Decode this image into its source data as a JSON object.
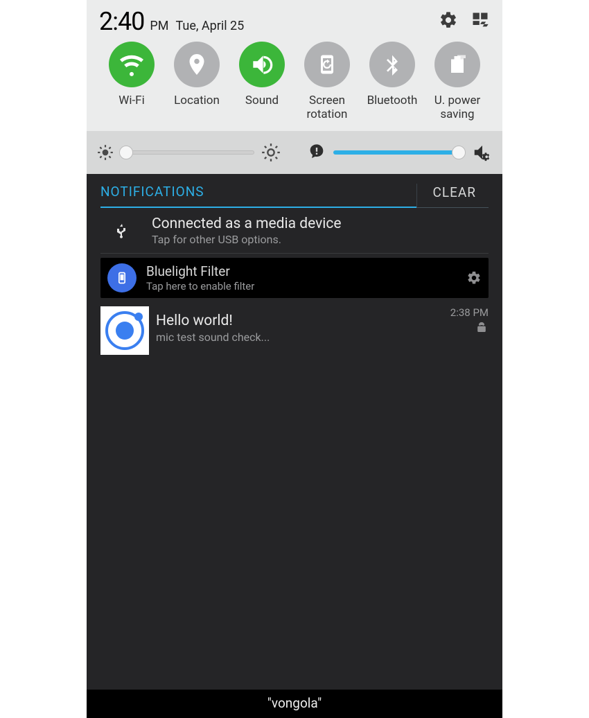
{
  "status": {
    "time": "2:40",
    "ampm": "PM",
    "date": "Tue, April 25"
  },
  "toggles": [
    {
      "label": "Wi-Fi",
      "on": true,
      "icon": "wifi-icon"
    },
    {
      "label": "Location",
      "on": false,
      "icon": "location-icon"
    },
    {
      "label": "Sound",
      "on": true,
      "icon": "sound-icon"
    },
    {
      "label": "Screen\nrotation",
      "on": false,
      "icon": "rotation-icon"
    },
    {
      "label": "Bluetooth",
      "on": false,
      "icon": "bluetooth-icon"
    },
    {
      "label": "U. power\nsaving",
      "on": false,
      "icon": "power-saving-icon"
    }
  ],
  "sliders": {
    "brightness_percent": 3,
    "volume_percent": 95
  },
  "notifications": {
    "header": "NOTIFICATIONS",
    "clear": "CLEAR",
    "items": {
      "usb": {
        "title": "Connected as a media device",
        "sub": "Tap for other USB options."
      },
      "bluelight": {
        "title": "Bluelight Filter",
        "sub": "Tap here to enable filter"
      },
      "hello": {
        "title": "Hello world!",
        "sub": "mic test sound check...",
        "time": "2:38 PM"
      }
    }
  },
  "caption": "\"vongola\""
}
